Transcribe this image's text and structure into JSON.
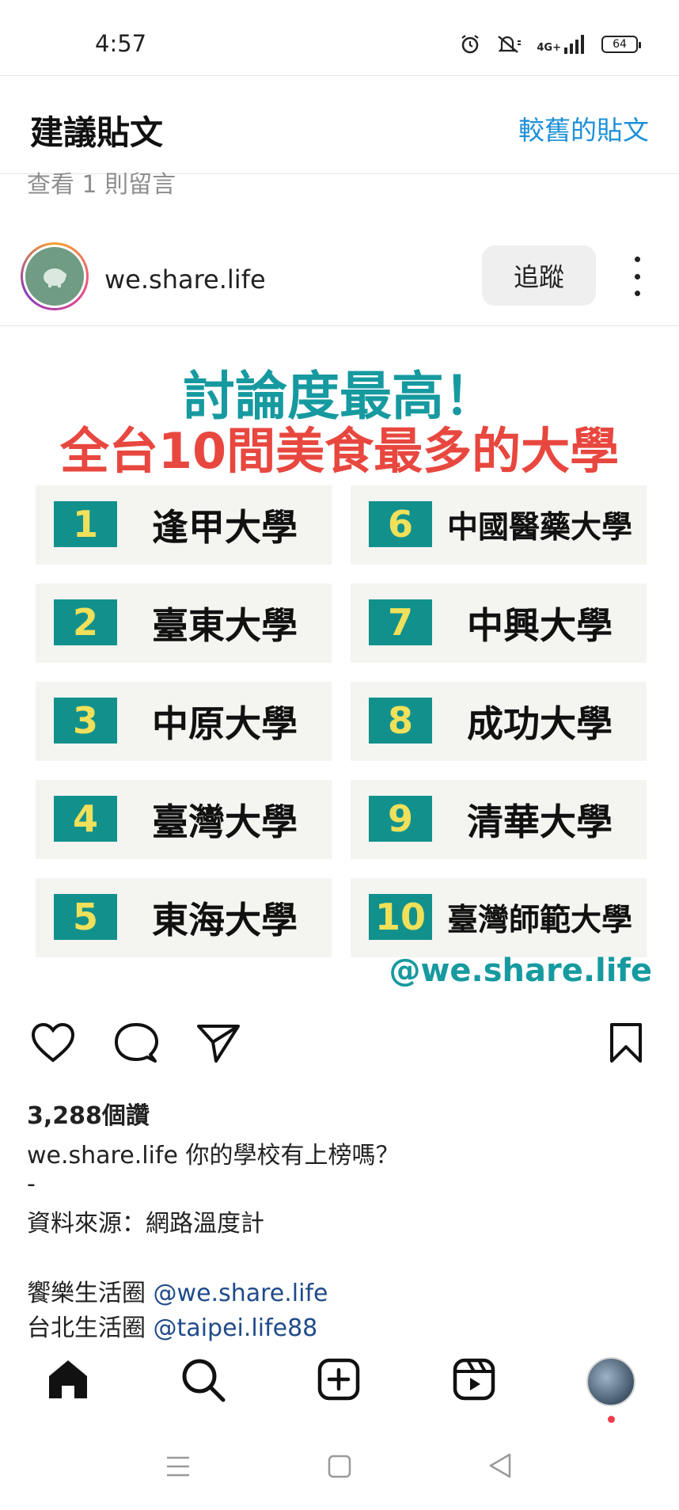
{
  "status_bar": {
    "time": "4:57",
    "network": "4G+",
    "battery": "64"
  },
  "header": {
    "title": "建議貼文",
    "older_posts": "較舊的貼文"
  },
  "view_comments": "查看 1 則留言",
  "post": {
    "username": "we.share.life",
    "follow_label": "追蹤",
    "image": {
      "title_line1": "討論度最高！",
      "title_line2": "全台10間美食最多的大學",
      "ranks": [
        {
          "rank": "1",
          "name": "逢甲大學"
        },
        {
          "rank": "2",
          "name": "臺東大學"
        },
        {
          "rank": "3",
          "name": "中原大學"
        },
        {
          "rank": "4",
          "name": "臺灣大學"
        },
        {
          "rank": "5",
          "name": "東海大學"
        },
        {
          "rank": "6",
          "name": "中國醫藥大學"
        },
        {
          "rank": "7",
          "name": "中興大學"
        },
        {
          "rank": "8",
          "name": "成功大學"
        },
        {
          "rank": "9",
          "name": "清華大學"
        },
        {
          "rank": "10",
          "name": "臺灣師範大學"
        }
      ],
      "watermark": "@we.share.life"
    },
    "likes": "3,288個讚",
    "caption": {
      "user": "we.share.life",
      "text": "你的學校有上榜嗎？",
      "dash": "-",
      "source": "資料來源：網路溫度計",
      "line4_text": "饗樂生活圈",
      "line4_mention": "@we.share.life",
      "line5_text": "台北生活圈",
      "line5_mention": "@taipei.life88"
    }
  },
  "icons": {
    "like": "heart-icon",
    "comment": "comment-icon",
    "share": "send-icon",
    "save": "bookmark-icon",
    "home": "home-icon",
    "search": "search-icon",
    "create": "plus-square-icon",
    "reels": "reels-icon"
  },
  "colors": {
    "accent": "#1e90d8",
    "teal": "#169aa0",
    "red": "#e8473f",
    "badge": "#12918c",
    "badge_text": "#f0e05a"
  }
}
